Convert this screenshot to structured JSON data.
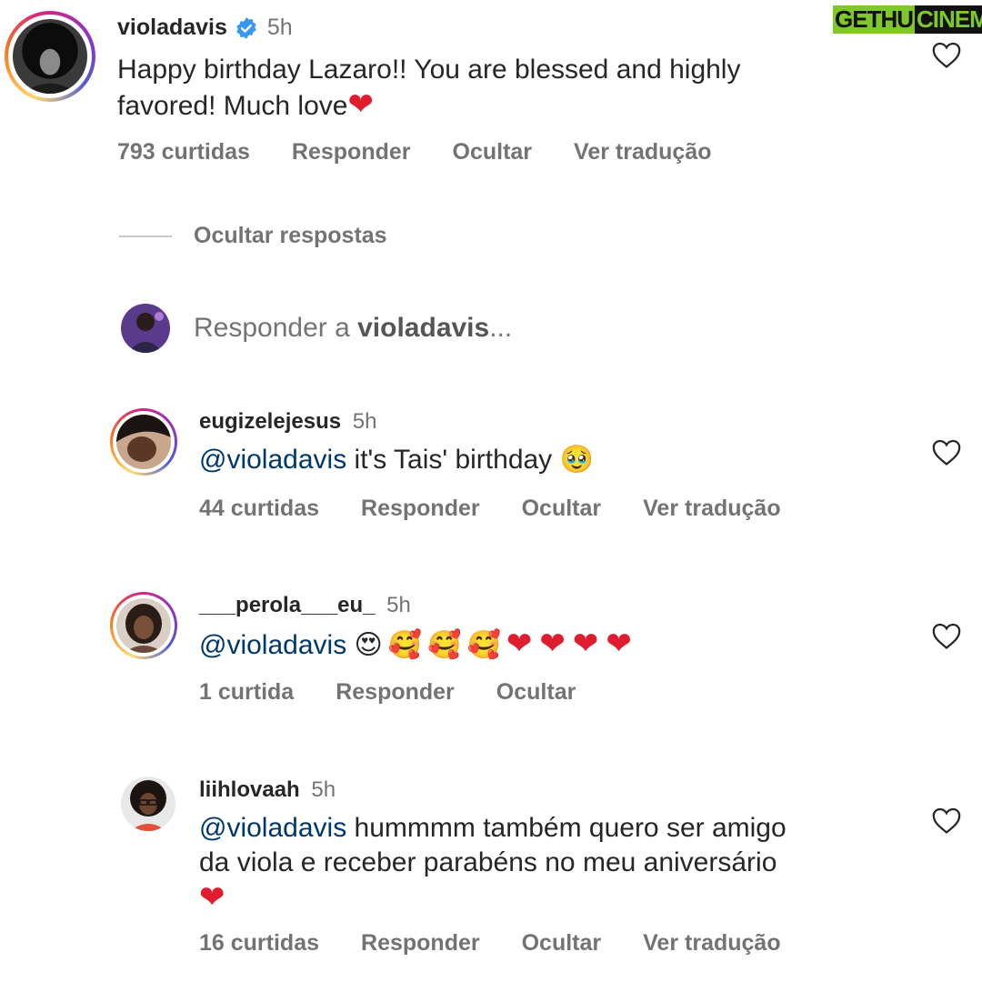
{
  "watermark": {
    "part1": "GETHU",
    "part2": "CINEMA"
  },
  "main_comment": {
    "username": "violadavis",
    "time": "5h",
    "text_line1": "Happy birthday Lazaro!! You are blessed and highly",
    "text_line2": "favored! Much love",
    "likes": "793 curtidas",
    "reply": "Responder",
    "hide": "Ocultar",
    "translate": "Ver tradução"
  },
  "hide_replies": "Ocultar respostas",
  "reply_input": {
    "prefix": "Responder a ",
    "target": "violadavis",
    "suffix": "..."
  },
  "replies": [
    {
      "username": "eugizelejesus",
      "time": "5h",
      "mention": "@violadavis",
      "text": " it's Tais' birthday ",
      "emoji": "🥹",
      "likes": "44 curtidas",
      "reply": "Responder",
      "hide": "Ocultar",
      "translate": "Ver tradução"
    },
    {
      "username": "___perola___eu_",
      "time": "5h",
      "mention": "@violadavis",
      "emojis": "😍🥰🥰🥰",
      "hearts": "❤❤❤❤",
      "likes": "1 curtida",
      "reply": "Responder",
      "hide": "Ocultar"
    },
    {
      "username": "liihlovaah",
      "time": "5h",
      "mention": "@violadavis",
      "text_line1": " hummmm também quero ser amigo",
      "text_line2": "da viola e receber parabéns no meu aniversário",
      "likes": "16 curtidas",
      "reply": "Responder",
      "hide": "Ocultar",
      "translate": "Ver tradução"
    }
  ],
  "colors": {
    "mention": "#00376b",
    "meta": "#737373",
    "heart_red": "#e01c2f",
    "verified": "#3897f0"
  }
}
